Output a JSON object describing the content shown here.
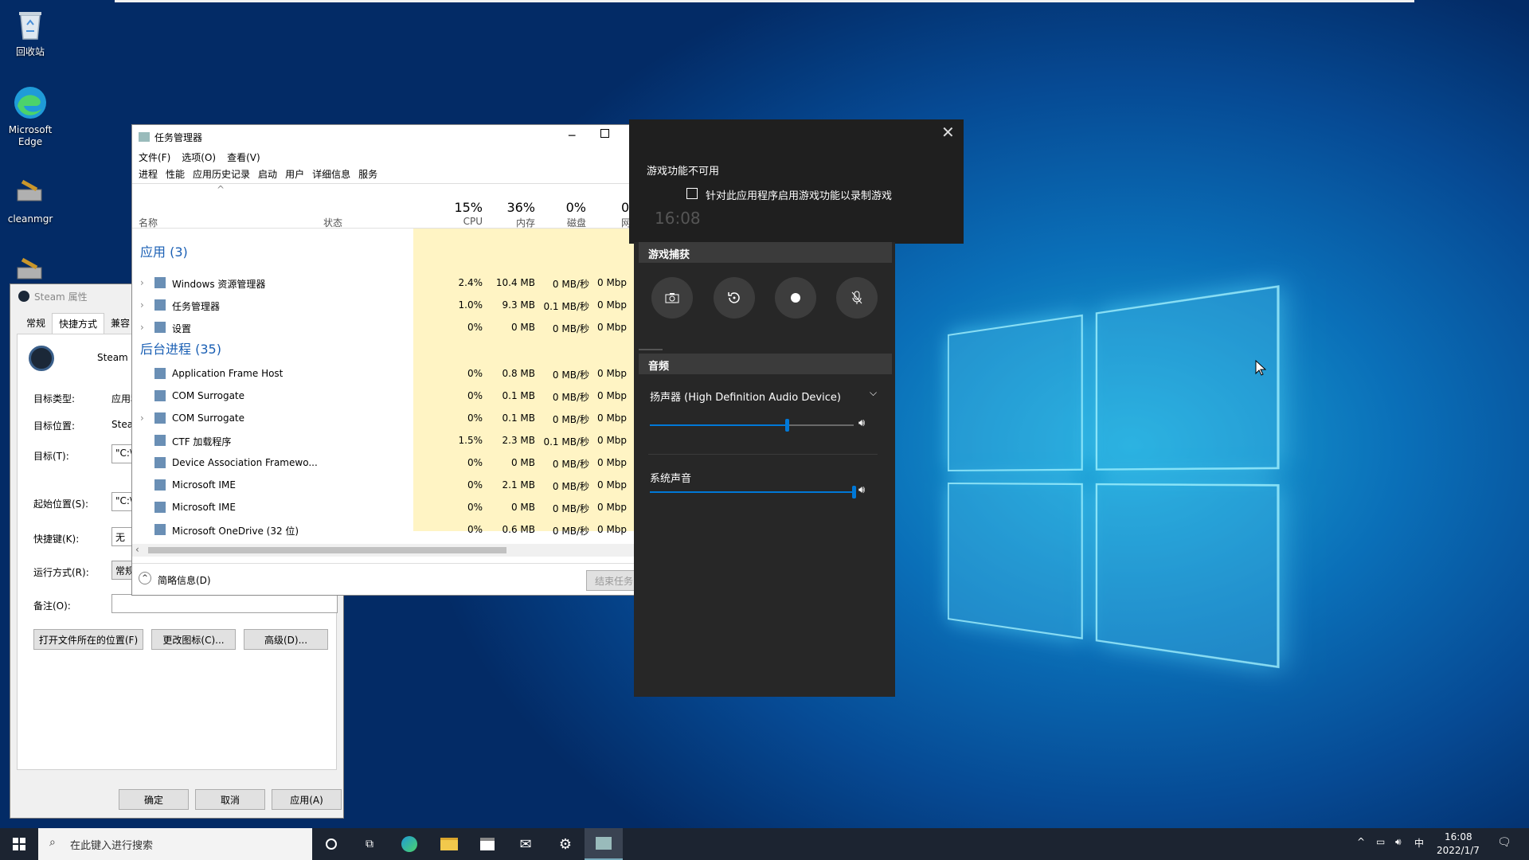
{
  "desktop": {
    "icons": [
      {
        "label": "回收站"
      },
      {
        "label": "Microsoft Edge"
      },
      {
        "label": "cleanmgr"
      }
    ]
  },
  "steam_props": {
    "title": "Steam 属性",
    "tabs": [
      "常规",
      "快捷方式",
      "兼容"
    ],
    "app_name": "Steam",
    "fields": {
      "target_type_label": "目标类型:",
      "target_type_value": "应用程",
      "target_loc_label": "目标位置:",
      "target_loc_value": "Steam",
      "target_label": "目标(T):",
      "target_value": "\"C:\\P",
      "start_label": "起始位置(S):",
      "start_value": "\"C:\\Pr",
      "hotkey_label": "快捷键(K):",
      "hotkey_value": "无",
      "run_label": "运行方式(R):",
      "run_value": "常规窗",
      "comment_label": "备注(O):",
      "comment_value": ""
    },
    "buttons": {
      "open_location": "打开文件所在的位置(F)",
      "change_icon": "更改图标(C)...",
      "advanced": "高级(D)...",
      "ok": "确定",
      "cancel": "取消",
      "apply": "应用(A)"
    }
  },
  "task_manager": {
    "title": "任务管理器",
    "menu": [
      "文件(F)",
      "选项(O)",
      "查看(V)"
    ],
    "tabs": [
      "进程",
      "性能",
      "应用历史记录",
      "启动",
      "用户",
      "详细信息",
      "服务"
    ],
    "headers": {
      "name": "名称",
      "status": "状态",
      "cpu_pct": "15%",
      "cpu": "CPU",
      "mem_pct": "36%",
      "mem": "内存",
      "disk_pct": "0%",
      "disk": "磁盘",
      "net_pct": "0",
      "net": "网"
    },
    "groups": {
      "apps": "应用 (3)",
      "background": "后台进程 (35)"
    },
    "rows": [
      {
        "name": "Windows 资源管理器",
        "cpu": "2.4%",
        "mem": "10.4 MB",
        "disk": "0 MB/秒",
        "net": "0 Mbp"
      },
      {
        "name": "任务管理器",
        "cpu": "1.0%",
        "mem": "9.3 MB",
        "disk": "0.1 MB/秒",
        "net": "0 Mbp"
      },
      {
        "name": "设置",
        "cpu": "0%",
        "mem": "0 MB",
        "disk": "0 MB/秒",
        "net": "0 Mbp"
      },
      {
        "name": "Application Frame Host",
        "cpu": "0%",
        "mem": "0.8 MB",
        "disk": "0 MB/秒",
        "net": "0 Mbp"
      },
      {
        "name": "COM Surrogate",
        "cpu": "0%",
        "mem": "0.1 MB",
        "disk": "0 MB/秒",
        "net": "0 Mbp"
      },
      {
        "name": "COM Surrogate",
        "cpu": "0%",
        "mem": "0.1 MB",
        "disk": "0 MB/秒",
        "net": "0 Mbp"
      },
      {
        "name": "CTF 加载程序",
        "cpu": "1.5%",
        "mem": "2.3 MB",
        "disk": "0.1 MB/秒",
        "net": "0 Mbp"
      },
      {
        "name": "Device Association Framewo...",
        "cpu": "0%",
        "mem": "0 MB",
        "disk": "0 MB/秒",
        "net": "0 Mbp"
      },
      {
        "name": "Microsoft IME",
        "cpu": "0%",
        "mem": "2.1 MB",
        "disk": "0 MB/秒",
        "net": "0 Mbp"
      },
      {
        "name": "Microsoft IME",
        "cpu": "0%",
        "mem": "0 MB",
        "disk": "0 MB/秒",
        "net": "0 Mbp"
      },
      {
        "name": "Microsoft OneDrive (32 位)",
        "cpu": "0%",
        "mem": "0.6 MB",
        "disk": "0 MB/秒",
        "net": "0 Mbp"
      }
    ],
    "fewer_details": "简略信息(D)",
    "end_task": "结束任务"
  },
  "game_bar": {
    "notice": "游戏功能不可用",
    "checkbox_label": "针对此应用程序启用游戏功能以录制游戏",
    "capture_title": "游戏捕获",
    "audio_title": "音频",
    "device": "扬声器 (High Definition Audio Device)",
    "device_volume": 0.67,
    "system_sound_label": "系统声音",
    "system_volume": 1.0,
    "ghost_clock": "16:08"
  },
  "taskbar": {
    "search_placeholder": "在此键入进行搜索",
    "time": "16:08",
    "date": "2022/1/7",
    "ime": "中"
  }
}
